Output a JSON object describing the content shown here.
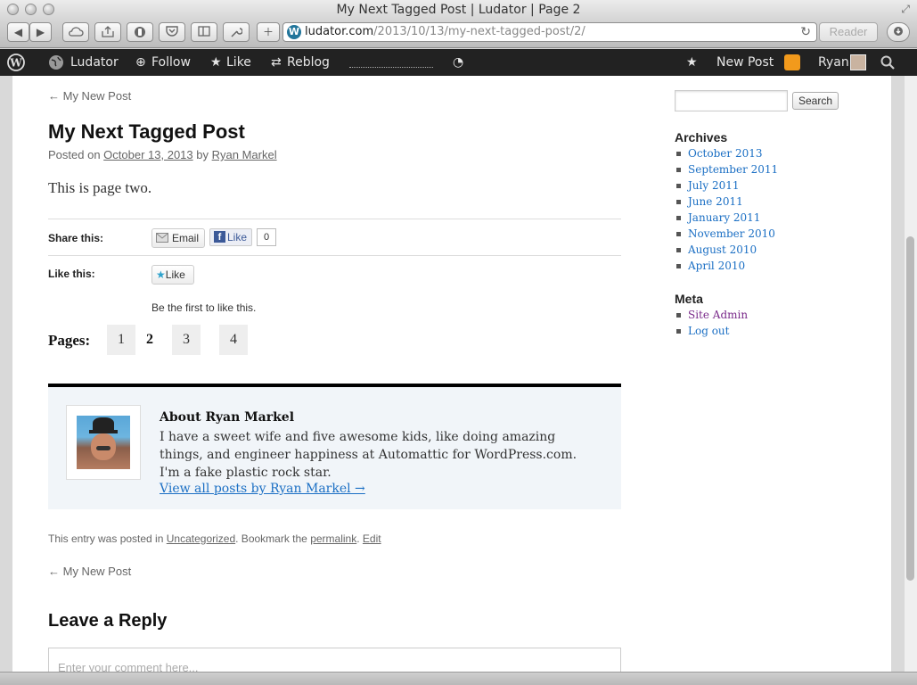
{
  "window": {
    "title": "My Next Tagged Post | Ludator | Page 2"
  },
  "browser": {
    "url_domain": "ludator.com",
    "url_path": "/2013/10/13/my-next-tagged-post/2/",
    "reader_label": "Reader",
    "colors": {
      "chrome": "#d6d6d6",
      "accent": "#21759b"
    }
  },
  "adminbar": {
    "site_name": "Ludator",
    "follow": "Follow",
    "like": "Like",
    "reblog": "Reblog",
    "new_post": "New Post",
    "user": "Ryan",
    "colors": {
      "bg": "#222222",
      "notification": "#f29a1c"
    }
  },
  "post": {
    "prev_link": "← My New Post",
    "title": "My Next Tagged Post",
    "posted_on_prefix": "Posted on",
    "date": "October 13, 2013",
    "by": "by",
    "author": "Ryan Markel",
    "body": "This is page two.",
    "share_label": "Share this:",
    "share_email": "Email",
    "fb_like": "Like",
    "fb_count": "0",
    "like_label": "Like this:",
    "like_button": "Like",
    "first_to_like": "Be the first to like this.",
    "pages_label": "Pages:",
    "pages": [
      "1",
      "2",
      "3",
      "4"
    ],
    "current_page": "2"
  },
  "author_box": {
    "name": "About Ryan Markel",
    "bio": "I have a sweet wife and five awesome kids, like doing amazing things, and engineer happiness at Automattic for WordPress.com. I'm a fake plastic rock star.",
    "link": "View all posts by Ryan Markel →"
  },
  "footer_meta": {
    "prefix": "This entry was posted in",
    "category": "Uncategorized",
    "mid": ". Bookmark the",
    "permalink": "permalink",
    "dot": ".",
    "edit": "Edit"
  },
  "bottom_prev_link": "← My New Post",
  "reply": {
    "title": "Leave a Reply",
    "placeholder": "Enter your comment here..."
  },
  "sidebar": {
    "search_button": "Search",
    "archives_title": "Archives",
    "archives": [
      "October 2013",
      "September 2011",
      "July 2011",
      "June 2011",
      "January 2011",
      "November 2010",
      "August 2010",
      "April 2010"
    ],
    "meta_title": "Meta",
    "meta_links": [
      "Site Admin",
      "Log out"
    ]
  }
}
